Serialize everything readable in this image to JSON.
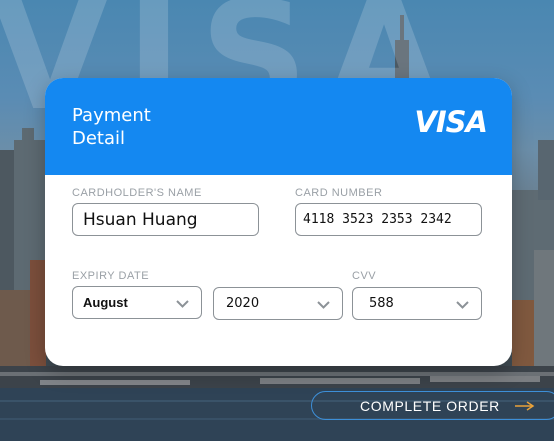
{
  "background": {
    "watermark": "VISA"
  },
  "card": {
    "title": "Payment Detail",
    "brand": "VISA",
    "header_color": "#1488f1"
  },
  "form": {
    "cardholder": {
      "label": "CARDHOLDER'S NAME",
      "value": "Hsuan Huang"
    },
    "card_number": {
      "label": "CARD NUMBER",
      "value": "4118 3523 2353 2342"
    },
    "expiry": {
      "label": "EXPIRY DATE",
      "month": "August",
      "year": "2020"
    },
    "cvv": {
      "label": "CVV",
      "value": "588"
    }
  },
  "actions": {
    "complete_order": "COMPLETE ORDER",
    "arrow_icon": "arrow-right-icon",
    "accent_color": "#e8a23a"
  }
}
